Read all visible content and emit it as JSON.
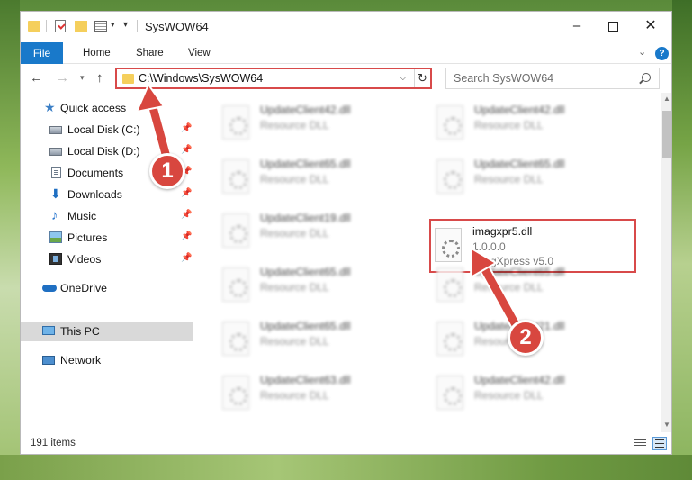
{
  "window": {
    "title": "SysWOW64",
    "ribbon_tabs": [
      "File",
      "Home",
      "Share",
      "View"
    ]
  },
  "navigation": {
    "address": "C:\\Windows\\SysWOW64",
    "search_placeholder": "Search SysWOW64"
  },
  "sidebar": {
    "items": [
      {
        "label": "Quick access",
        "icon": "star-icon",
        "pinned": false
      },
      {
        "label": "Local Disk (C:)",
        "icon": "disk-icon",
        "pinned": true
      },
      {
        "label": "Local Disk (D:)",
        "icon": "disk-icon",
        "pinned": true
      },
      {
        "label": "Documents",
        "icon": "document-icon",
        "pinned": true
      },
      {
        "label": "Downloads",
        "icon": "download-icon",
        "pinned": true
      },
      {
        "label": "Music",
        "icon": "music-icon",
        "pinned": true
      },
      {
        "label": "Pictures",
        "icon": "picture-icon",
        "pinned": true
      },
      {
        "label": "Videos",
        "icon": "video-icon",
        "pinned": true
      },
      {
        "label": "OneDrive",
        "icon": "cloud-icon",
        "pinned": false
      },
      {
        "label": "This PC",
        "icon": "computer-icon",
        "pinned": false,
        "selected": true
      },
      {
        "label": "Network",
        "icon": "network-icon",
        "pinned": false
      }
    ]
  },
  "files": {
    "left_column": [
      {
        "name": "UpdateClient42.dll",
        "desc": "Resource DLL"
      },
      {
        "name": "UpdateClient65.dll",
        "desc": "Resource DLL"
      },
      {
        "name": "UpdateClient19.dll",
        "desc": "Resource DLL"
      },
      {
        "name": "UpdateClient65.dll",
        "desc": "Resource DLL"
      },
      {
        "name": "UpdateClient65.dll",
        "desc": "Resource DLL"
      },
      {
        "name": "UpdateClient63.dll",
        "desc": "Resource DLL"
      }
    ],
    "right_column": [
      {
        "name": "UpdateClient42.dll",
        "desc": "Resource DLL"
      },
      {
        "name": "UpdateClient65.dll",
        "desc": "Resource DLL"
      },
      {
        "name": "imagxpr5.dll",
        "version": "1.0.0.0",
        "desc": "ImagXpress v5.0",
        "highlighted": true
      },
      {
        "name": "UpdateClient65.dll",
        "desc": "Resource DLL"
      },
      {
        "name": "UpdateClient21.dll",
        "desc": "Resource DLL"
      },
      {
        "name": "UpdateClient42.dll",
        "desc": "Resource DLL"
      }
    ]
  },
  "status": {
    "item_count": "191 items"
  },
  "annotations": {
    "step1": "1",
    "step2": "2",
    "color": "#d8473f"
  }
}
